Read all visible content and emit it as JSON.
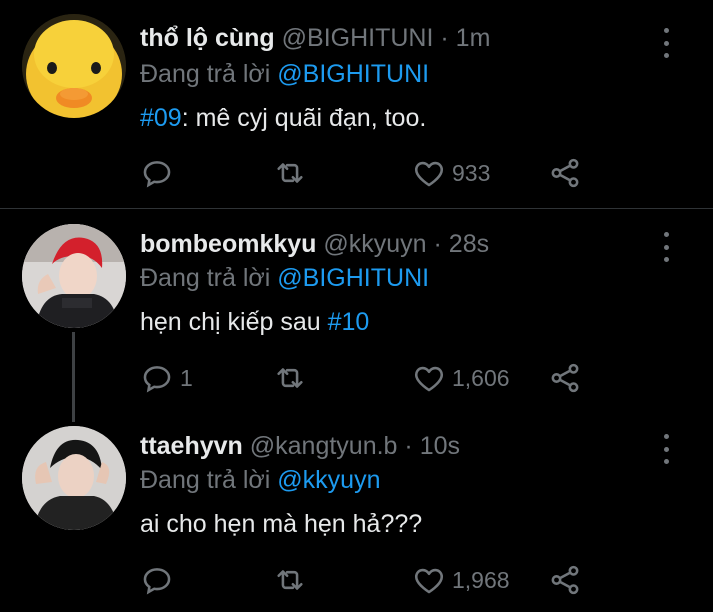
{
  "tweets": [
    {
      "name": "thổ lộ cùng",
      "handle": "@BIGHITUNI",
      "time": "· 1m",
      "reply_prefix": "Đang trả lời",
      "reply_to": "@BIGHITUNI",
      "body_tag": "#09",
      "body_text": ": mê cyj quãi đạn, too.",
      "stats": {
        "replies": "",
        "retweets": "",
        "likes": "933"
      }
    },
    {
      "name": "bombeomkkyu",
      "handle": "@kkyuyn",
      "time": "· 28s",
      "reply_prefix": "Đang trả lời",
      "reply_to": "@BIGHITUNI",
      "body_text": "hẹn chị kiếp sau ",
      "body_tag": "#10",
      "stats": {
        "replies": "1",
        "retweets": "",
        "likes": "1,606"
      }
    },
    {
      "name": "ttaehyvn",
      "handle": "@kangtyun.b",
      "time": "· 10s",
      "reply_prefix": "Đang trả lời",
      "reply_to": "@kkyuyn",
      "body_text": "ai cho hẹn mà hẹn hả???",
      "stats": {
        "replies": "",
        "retweets": "",
        "likes": "1,968"
      }
    }
  ],
  "colors": {
    "background": "#000000",
    "text": "#e7e9ea",
    "muted": "#71767b",
    "link": "#1d9bf0"
  },
  "icons": [
    "reply-icon",
    "retweet-icon",
    "like-icon",
    "share-icon",
    "more-icon"
  ]
}
